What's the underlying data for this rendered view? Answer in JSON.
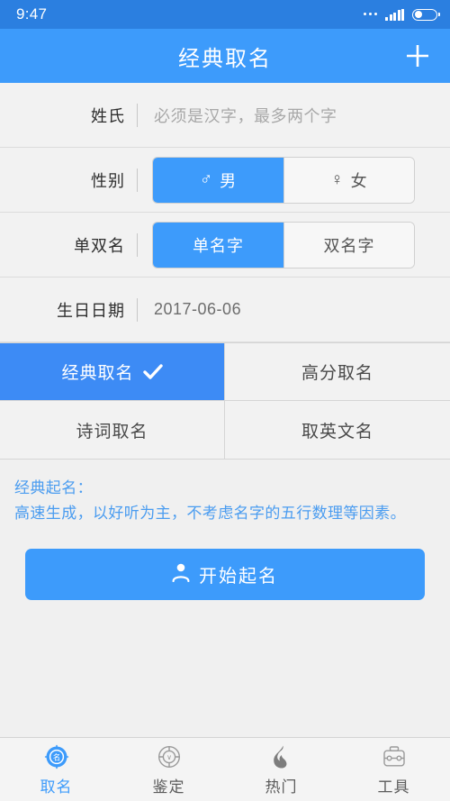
{
  "status_bar": {
    "time": "9:47",
    "icons": [
      "more-dots-icon",
      "signal-icon",
      "battery-icon"
    ]
  },
  "header": {
    "title": "经典取名",
    "add_icon": "plus-icon"
  },
  "form": {
    "surname": {
      "label": "姓氏",
      "value": "",
      "placeholder": "必须是汉字，最多两个字"
    },
    "gender": {
      "label": "性别",
      "options": [
        {
          "label": "男",
          "symbol": "♂",
          "selected": true
        },
        {
          "label": "女",
          "symbol": "♀",
          "selected": false
        }
      ]
    },
    "name_length": {
      "label": "单双名",
      "options": [
        {
          "label": "单名字",
          "selected": true
        },
        {
          "label": "双名字",
          "selected": false
        }
      ]
    },
    "birthday": {
      "label": "生日日期",
      "value": "2017-06-06"
    }
  },
  "modes": [
    {
      "label": "经典取名",
      "selected": true
    },
    {
      "label": "高分取名",
      "selected": false
    },
    {
      "label": "诗词取名",
      "selected": false
    },
    {
      "label": "取英文名",
      "selected": false
    }
  ],
  "description": {
    "title": "经典起名：",
    "body": "高速生成，以好听为主，不考虑名字的五行数理等因素。"
  },
  "cta": {
    "label": "开始起名",
    "icon": "person-icon"
  },
  "bottom_nav": [
    {
      "label": "取名",
      "icon": "name-compass-icon",
      "active": true
    },
    {
      "label": "鉴定",
      "icon": "appraise-compass-icon",
      "active": false
    },
    {
      "label": "热门",
      "icon": "flame-icon",
      "active": false
    },
    {
      "label": "工具",
      "icon": "toolbox-icon",
      "active": false
    }
  ],
  "colors": {
    "accent": "#3d9bfb",
    "status_bar": "#2b7fe0",
    "mode_active": "#3d8bf5",
    "page_bg": "#f0f0f0",
    "row_bg": "#f2f2f2",
    "nav_inactive": "#5c5c5c",
    "desc_text": "#4a9cf0"
  }
}
